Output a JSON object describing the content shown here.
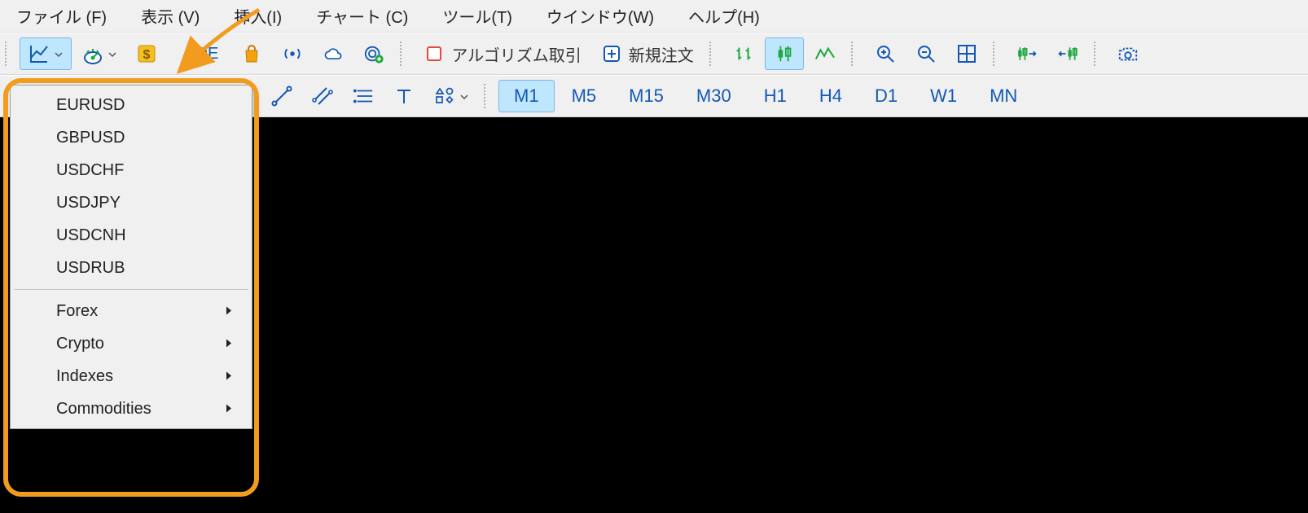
{
  "menubar": {
    "items": [
      "ファイル (F)",
      "表示 (V)",
      "挿入(I)",
      "チャート (C)",
      "ツール(T)",
      "ウインドウ(W)",
      "ヘルプ(H)"
    ]
  },
  "toolbar1": {
    "ide_label": "IDE",
    "algo_label": "アルゴリズム取引",
    "new_order_label": "新規注文"
  },
  "dropdown": {
    "symbols": [
      "EURUSD",
      "GBPUSD",
      "USDCHF",
      "USDJPY",
      "USDCNH",
      "USDRUB"
    ],
    "groups": [
      "Forex",
      "Crypto",
      "Indexes",
      "Commodities"
    ]
  },
  "timeframes": [
    "M1",
    "M5",
    "M15",
    "M30",
    "H1",
    "H4",
    "D1",
    "W1",
    "MN"
  ],
  "selected_timeframe": "M1",
  "colors": {
    "annotation": "#F29C1F",
    "link": "#1458B3",
    "green": "#1FA83F",
    "gold": "#F2A40A"
  }
}
